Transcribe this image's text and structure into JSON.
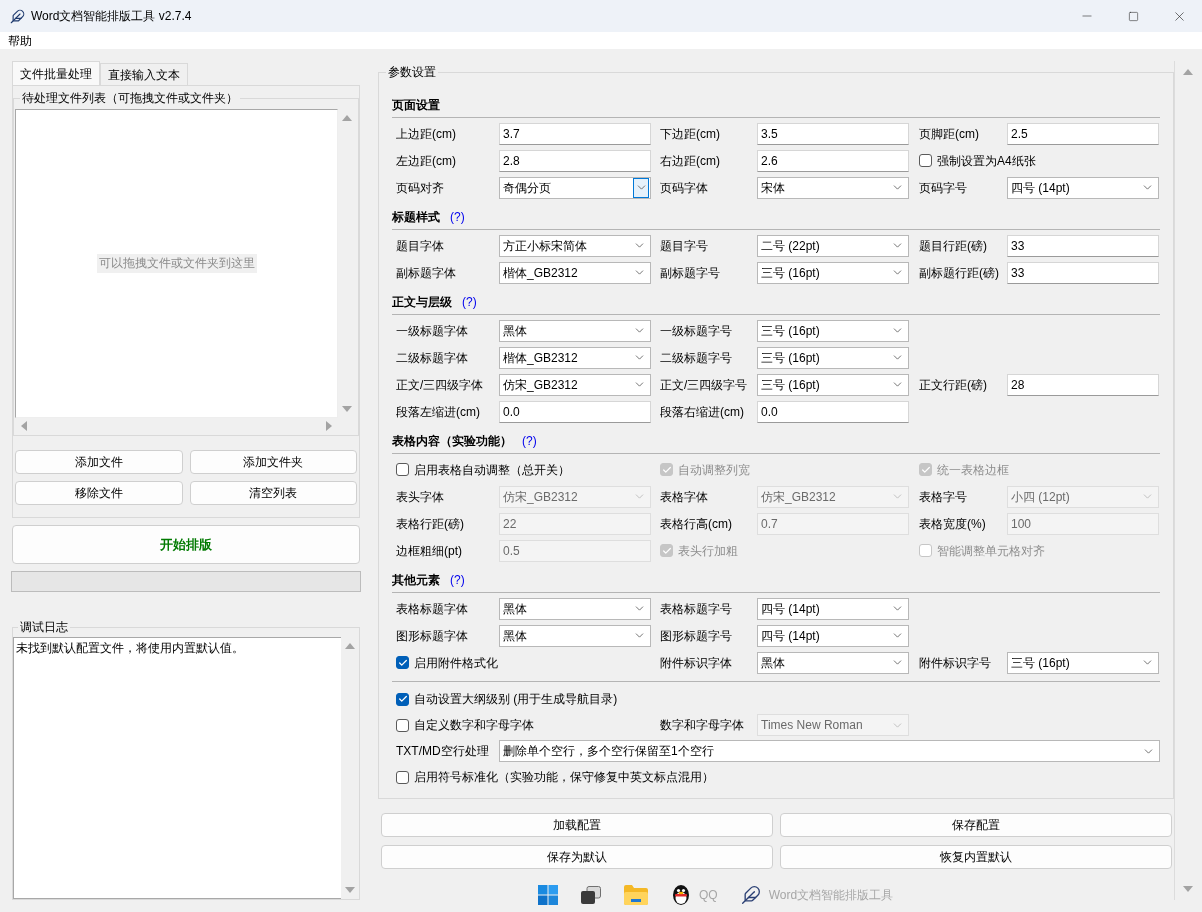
{
  "window": {
    "title": "Word文档智能排版工具 v2.7.4"
  },
  "menu": [
    {
      "label": "帮助"
    }
  ],
  "left": {
    "tabs": [
      {
        "label": "文件批量处理",
        "selected": true
      },
      {
        "label": "直接输入文本",
        "selected": false
      }
    ],
    "file_list": {
      "title": "待处理文件列表（可拖拽文件或文件夹）",
      "drop_hint": "可以拖拽文件或文件夹到这里"
    },
    "file_buttons": [
      "添加文件",
      "添加文件夹",
      "移除文件",
      "清空列表"
    ],
    "start_button": "开始排版",
    "progress": {
      "level": 0
    },
    "log": {
      "title": "调试日志",
      "lines": [
        "未找到默认配置文件，将使用内置默认值。"
      ]
    }
  },
  "settings": {
    "title": "参数设置",
    "sections": [
      {
        "title": "页面设置",
        "rows": [
          [
            {
              "kind": "entry",
              "label": "上边距(cm)",
              "value": "3.7",
              "disabled": false
            },
            {
              "kind": "entry",
              "label": "下边距(cm)",
              "value": "3.5",
              "disabled": false
            },
            {
              "kind": "entry",
              "label": "页脚距(cm)",
              "value": "2.5",
              "disabled": false
            }
          ],
          [
            {
              "kind": "entry",
              "label": "左边距(cm)",
              "value": "2.8",
              "disabled": false
            },
            {
              "kind": "entry",
              "label": "右边距(cm)",
              "value": "2.6",
              "disabled": false
            },
            {
              "kind": "check",
              "label": "强制设置为A4纸张",
              "checked": false,
              "disabled": false
            }
          ],
          [
            {
              "kind": "combo",
              "label": "页码对齐",
              "value": "奇偶分页",
              "disabled": false,
              "focused": true
            },
            {
              "kind": "combo",
              "label": "页码字体",
              "value": "宋体",
              "disabled": false,
              "focused": false
            },
            {
              "kind": "combo",
              "label": "页码字号",
              "value": "四号 (14pt)",
              "disabled": false,
              "focused": false
            }
          ]
        ]
      },
      {
        "title": "标题样式",
        "help": "(?)",
        "rows": [
          [
            {
              "kind": "combo",
              "label": "题目字体",
              "value": "方正小标宋简体",
              "disabled": false,
              "focused": false
            },
            {
              "kind": "combo",
              "label": "题目字号",
              "value": "二号 (22pt)",
              "disabled": false,
              "focused": false
            },
            {
              "kind": "entry",
              "label": "题目行距(磅)",
              "value": "33",
              "disabled": false
            }
          ],
          [
            {
              "kind": "combo",
              "label": "副标题字体",
              "value": "楷体_GB2312",
              "disabled": false,
              "focused": false
            },
            {
              "kind": "combo",
              "label": "副标题字号",
              "value": "三号 (16pt)",
              "disabled": false,
              "focused": false
            },
            {
              "kind": "entry",
              "label": "副标题行距(磅)",
              "value": "33",
              "disabled": false
            }
          ]
        ]
      },
      {
        "title": "正文与层级",
        "help": "(?)",
        "rows": [
          [
            {
              "kind": "combo",
              "label": "一级标题字体",
              "value": "黑体",
              "disabled": false,
              "focused": false
            },
            {
              "kind": "combo",
              "label": "一级标题字号",
              "value": "三号 (16pt)",
              "disabled": false,
              "focused": false
            }
          ],
          [
            {
              "kind": "combo",
              "label": "二级标题字体",
              "value": "楷体_GB2312",
              "disabled": false,
              "focused": false
            },
            {
              "kind": "combo",
              "label": "二级标题字号",
              "value": "三号 (16pt)",
              "disabled": false,
              "focused": false
            }
          ],
          [
            {
              "kind": "combo",
              "label": "正文/三四级字体",
              "value": "仿宋_GB2312",
              "disabled": false,
              "focused": false
            },
            {
              "kind": "combo",
              "label": "正文/三四级字号",
              "value": "三号 (16pt)",
              "disabled": false,
              "focused": false
            },
            {
              "kind": "entry",
              "label": "正文行距(磅)",
              "value": "28",
              "disabled": false
            }
          ],
          [
            {
              "kind": "entry",
              "label": "段落左缩进(cm)",
              "value": "0.0",
              "disabled": false
            },
            {
              "kind": "entry",
              "label": "段落右缩进(cm)",
              "value": "0.0",
              "disabled": false
            }
          ]
        ]
      },
      {
        "title": "表格内容（实验功能）",
        "help": "(?)",
        "rows": [
          [
            {
              "kind": "check",
              "label": "启用表格自动调整（总开关）",
              "checked": false,
              "disabled": false
            },
            {
              "kind": "check",
              "label": "自动调整列宽",
              "checked": true,
              "disabled": true
            },
            {
              "kind": "check",
              "label": "统一表格边框",
              "checked": true,
              "disabled": true
            }
          ],
          [
            {
              "kind": "combo",
              "label": "表头字体",
              "value": "仿宋_GB2312",
              "disabled": true,
              "focused": false
            },
            {
              "kind": "combo",
              "label": "表格字体",
              "value": "仿宋_GB2312",
              "disabled": true,
              "focused": false
            },
            {
              "kind": "combo",
              "label": "表格字号",
              "value": "小四 (12pt)",
              "disabled": true,
              "focused": false
            }
          ],
          [
            {
              "kind": "entry",
              "label": "表格行距(磅)",
              "value": "22",
              "disabled": true
            },
            {
              "kind": "entry",
              "label": "表格行高(cm)",
              "value": "0.7",
              "disabled": true
            },
            {
              "kind": "entry",
              "label": "表格宽度(%)",
              "value": "100",
              "disabled": true
            }
          ],
          [
            {
              "kind": "entry",
              "label": "边框粗细(pt)",
              "value": "0.5",
              "disabled": true
            },
            {
              "kind": "check",
              "label": "表头行加粗",
              "checked": true,
              "disabled": true
            },
            {
              "kind": "check",
              "label": "智能调整单元格对齐",
              "checked": false,
              "disabled": true
            }
          ]
        ]
      },
      {
        "title": "其他元素",
        "help": "(?)",
        "rows": [
          [
            {
              "kind": "combo",
              "label": "表格标题字体",
              "value": "黑体",
              "disabled": false,
              "focused": false
            },
            {
              "kind": "combo",
              "label": "表格标题字号",
              "value": "四号 (14pt)",
              "disabled": false,
              "focused": false
            }
          ],
          [
            {
              "kind": "combo",
              "label": "图形标题字体",
              "value": "黑体",
              "disabled": false,
              "focused": false
            },
            {
              "kind": "combo",
              "label": "图形标题字号",
              "value": "四号 (14pt)",
              "disabled": false,
              "focused": false
            }
          ],
          [
            {
              "kind": "check",
              "label": "启用附件格式化",
              "checked": true,
              "disabled": false
            },
            {
              "kind": "combo",
              "label": "附件标识字体",
              "value": "黑体",
              "disabled": false,
              "focused": false
            },
            {
              "kind": "combo",
              "label": "附件标识字号",
              "value": "三号 (16pt)",
              "disabled": false,
              "focused": false
            }
          ]
        ]
      },
      {
        "rows": [
          [
            {
              "kind": "check",
              "label": "自动设置大纲级别 (用于生成导航目录)",
              "checked": true,
              "disabled": false
            }
          ],
          [
            {
              "kind": "check",
              "label": "自定义数字和字母字体",
              "checked": false,
              "disabled": false
            },
            {
              "kind": "combo",
              "label": "数字和字母字体",
              "value": "Times New Roman",
              "disabled": true,
              "focused": false
            }
          ],
          [
            {
              "kind": "combo",
              "label": "TXT/MD空行处理",
              "value": "删除单个空行，多个空行保留至1个空行",
              "disabled": false,
              "focused": false
            }
          ],
          [
            {
              "kind": "check",
              "label": "启用符号标准化（实验功能，保守修复中英文标点混用）",
              "checked": false,
              "disabled": false
            }
          ]
        ]
      }
    ]
  },
  "config_buttons": [
    "加载配置",
    "保存配置",
    "保存为默认",
    "恢复内置默认"
  ],
  "taskbar": {
    "items": [
      {
        "kind": "start"
      },
      {
        "kind": "taskview"
      },
      {
        "kind": "explorer"
      },
      {
        "kind": "chat",
        "label": "QQ"
      },
      {
        "kind": "app",
        "label": "Word文档智能排版工具"
      }
    ]
  }
}
